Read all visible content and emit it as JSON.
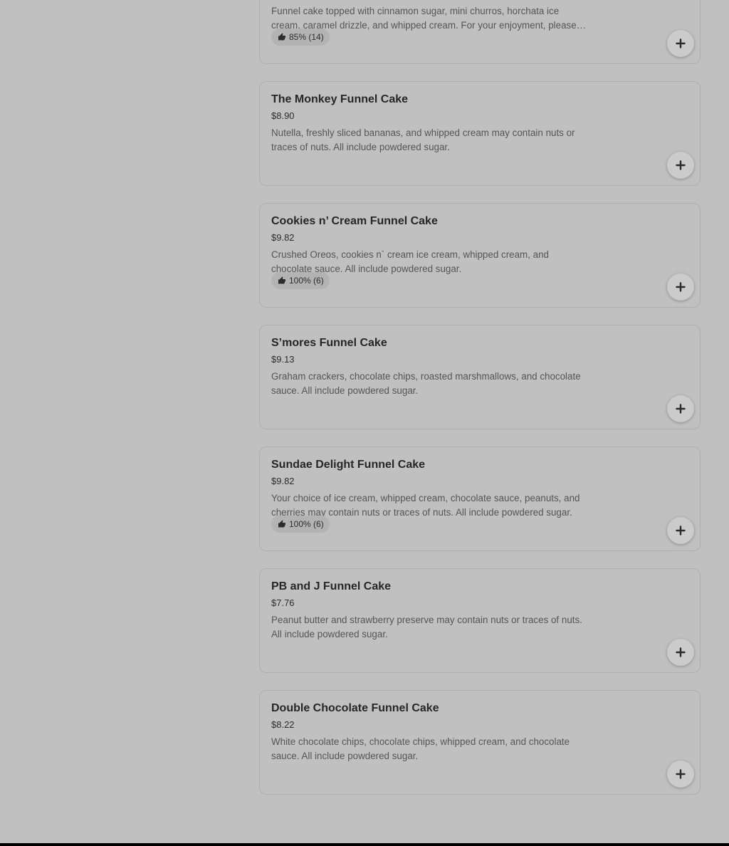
{
  "menu": {
    "items": [
      {
        "name": "",
        "price": "",
        "description": "Funnel cake topped with cinnamon sugar, mini churros, horchata ice cream, caramel drizzle, and whipped cream. For your enjoyment, please be aware that this item may contain nuts or traces of nuts. All include powdered sugar.",
        "rating": "85% (14)"
      },
      {
        "name": "The Monkey Funnel Cake",
        "price": "$8.90",
        "description": "Nutella, freshly sliced bananas, and whipped cream may contain nuts or traces of nuts. All include powdered sugar.",
        "rating": ""
      },
      {
        "name": "Cookies n’ Cream Funnel Cake",
        "price": "$9.82",
        "description": "Crushed Oreos, cookies n` cream ice cream, whipped cream, and chocolate sauce. All include powdered sugar.",
        "rating": "100% (6)"
      },
      {
        "name": "S’mores Funnel Cake",
        "price": "$9.13",
        "description": "Graham crackers, chocolate chips, roasted marshmallows, and chocolate sauce. All include powdered sugar.",
        "rating": ""
      },
      {
        "name": "Sundae Delight Funnel Cake",
        "price": "$9.82",
        "description": "Your choice of ice cream, whipped cream, chocolate sauce, peanuts, and cherries may contain nuts or traces of nuts. All include powdered sugar.",
        "rating": "100% (6)"
      },
      {
        "name": "PB and J Funnel Cake",
        "price": "$7.76",
        "description": "Peanut butter and strawberry preserve may contain nuts or traces of nuts. All include powdered sugar.",
        "rating": ""
      },
      {
        "name": "Double Chocolate Funnel Cake",
        "price": "$8.22",
        "description": "White chocolate chips, chocolate chips, whipped cream, and chocolate sauce. All include powdered sugar.",
        "rating": ""
      }
    ]
  },
  "icons": {
    "rating": "thumbs-up-icon",
    "add": "plus-icon"
  },
  "colors": {
    "overlay_background": "#c0c0c0",
    "text_primary": "#262626",
    "text_secondary": "#555555",
    "rating_pill": "#b3b3b3",
    "add_button": "#cbcbcb"
  }
}
